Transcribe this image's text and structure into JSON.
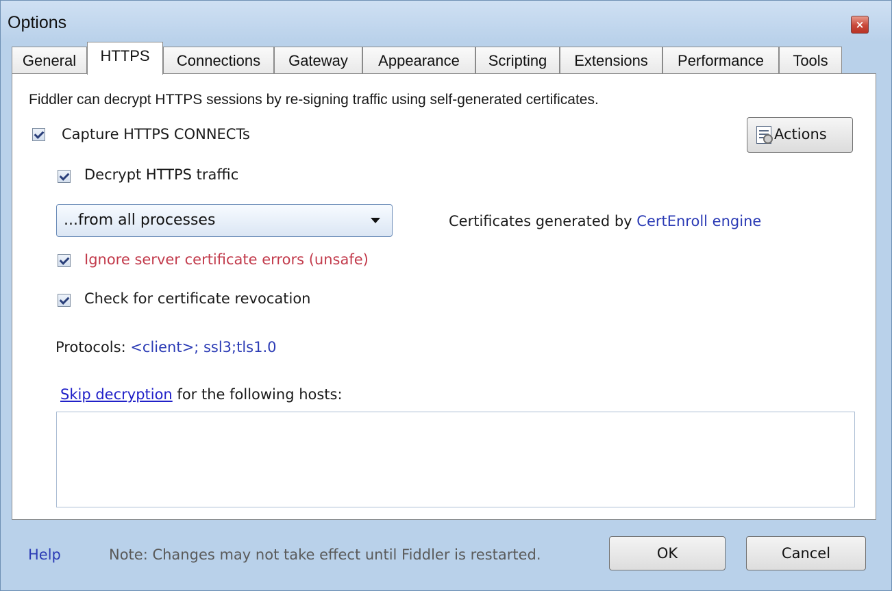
{
  "window": {
    "title": "Options",
    "close_label": "×"
  },
  "tabs": [
    {
      "label": "General"
    },
    {
      "label": "HTTPS"
    },
    {
      "label": "Connections"
    },
    {
      "label": "Gateway"
    },
    {
      "label": "Appearance"
    },
    {
      "label": "Scripting"
    },
    {
      "label": "Extensions"
    },
    {
      "label": "Performance"
    },
    {
      "label": "Tools"
    }
  ],
  "active_tab": "HTTPS",
  "https": {
    "description": "Fiddler can decrypt HTTPS sessions by re-signing traffic using self-generated certificates.",
    "capture_connects": {
      "label": "Capture HTTPS CONNECTs",
      "checked": true
    },
    "actions_label": "Actions",
    "decrypt_traffic": {
      "label": "Decrypt HTTPS traffic",
      "checked": true
    },
    "process_filter": {
      "value": "...from all processes"
    },
    "cert_engine": {
      "prefix": "Certificates generated by ",
      "engine": "CertEnroll engine"
    },
    "ignore_errors": {
      "label": "Ignore server certificate errors (unsafe)",
      "checked": true
    },
    "check_revocation": {
      "label": "Check for certificate revocation",
      "checked": true
    },
    "protocols": {
      "label": "Protocols: ",
      "value": "<client>; ssl3;tls1.0"
    },
    "skip_decryption": {
      "link": "Skip decryption",
      "suffix": " for the following hosts:",
      "hosts_value": ""
    }
  },
  "footer": {
    "help": "Help",
    "note": "Note: Changes may not take effect until Fiddler is restarted.",
    "ok": "OK",
    "cancel": "Cancel"
  },
  "colors": {
    "title_bar": "#b9d1ea",
    "link_blue": "#2b3bb5",
    "warning_red": "#c23a4b",
    "close_button": "#c9483a"
  }
}
